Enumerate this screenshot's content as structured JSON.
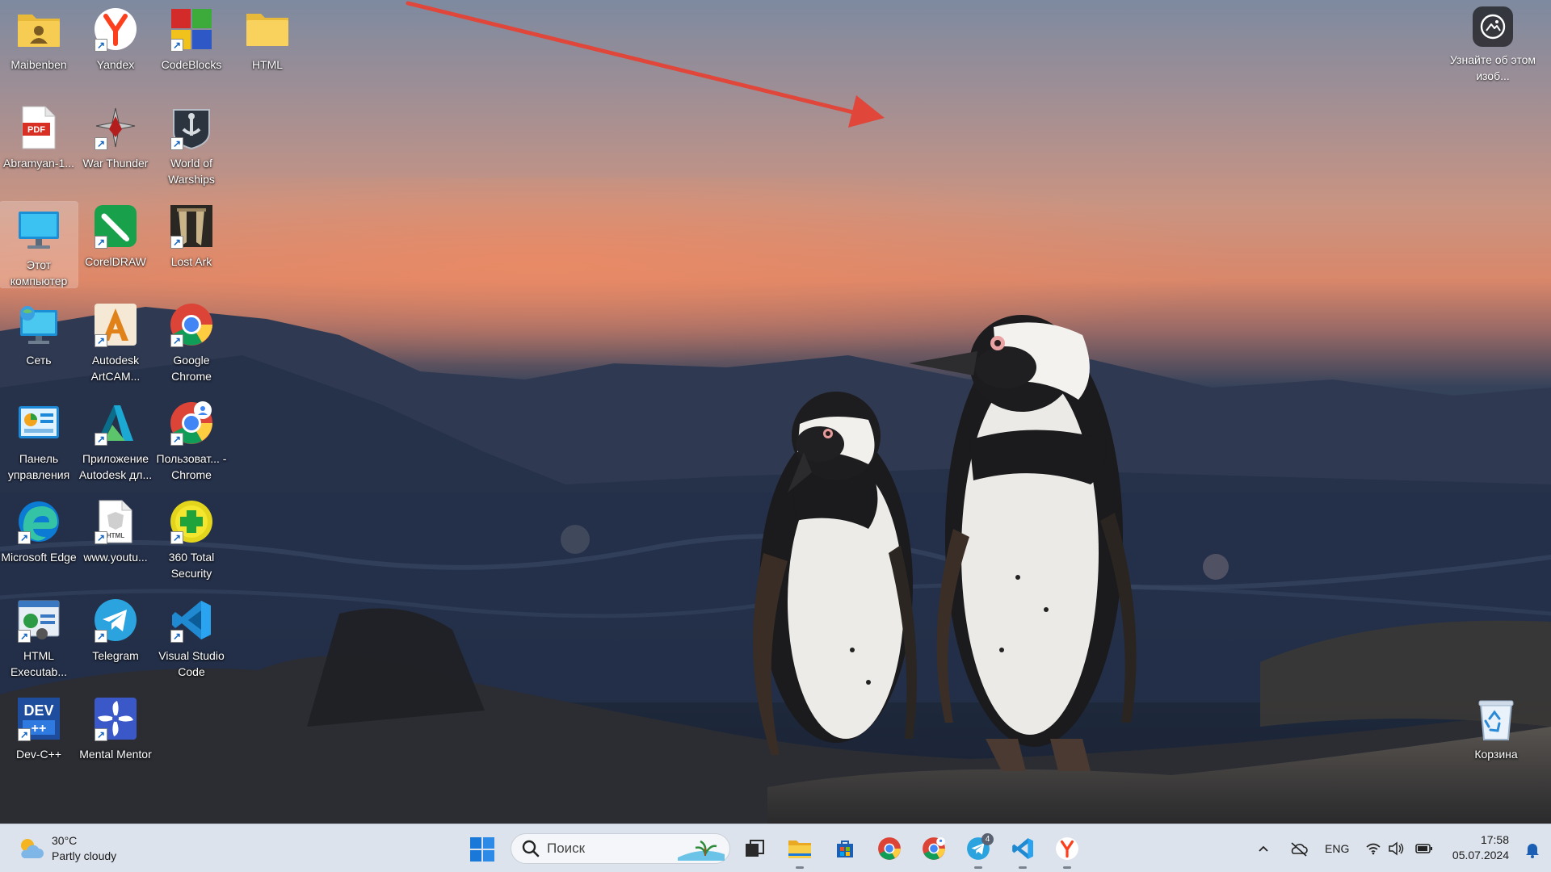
{
  "desktop": {
    "icons": [
      {
        "label": "Maibenben",
        "icon": "user-folder-icon"
      },
      {
        "label": "Yandex",
        "icon": "yandex-browser-icon"
      },
      {
        "label": "CodeBlocks",
        "icon": "codeblocks-icon"
      },
      {
        "label": "HTML",
        "icon": "folder-icon"
      },
      {
        "label": "Abramyan-1...",
        "icon": "pdf-file-icon"
      },
      {
        "label": "War Thunder",
        "icon": "war-thunder-icon"
      },
      {
        "label": "World of Warships",
        "icon": "world-of-warships-icon"
      },
      {
        "label": "Этот компьютер",
        "icon": "this-pc-icon"
      },
      {
        "label": "CorelDRAW",
        "icon": "coreldraw-icon"
      },
      {
        "label": "Lost Ark",
        "icon": "lost-ark-icon"
      },
      {
        "label": "Сеть",
        "icon": "network-icon"
      },
      {
        "label": "Autodesk ArtCAM...",
        "icon": "artcam-icon"
      },
      {
        "label": "Google Chrome",
        "icon": "chrome-icon"
      },
      {
        "label": "Панель управления",
        "icon": "control-panel-icon"
      },
      {
        "label": "Приложение Autodesk дл...",
        "icon": "autodesk-app-icon"
      },
      {
        "label": "Пользоват... - Chrome",
        "icon": "chrome-profile-icon"
      },
      {
        "label": "Microsoft Edge",
        "icon": "edge-icon"
      },
      {
        "label": "www.youtu...",
        "icon": "html-file-icon"
      },
      {
        "label": "360 Total Security",
        "icon": "360-security-icon"
      },
      {
        "label": "HTML Executab...",
        "icon": "html-executable-icon"
      },
      {
        "label": "Telegram",
        "icon": "telegram-icon"
      },
      {
        "label": "Visual Studio Code",
        "icon": "vscode-icon"
      },
      {
        "label": "Dev-C++",
        "icon": "devcpp-icon"
      },
      {
        "label": "Mental Mentor",
        "icon": "mental-mentor-icon"
      }
    ],
    "recycle_bin": {
      "label": "Корзина",
      "icon": "recycle-bin-icon"
    },
    "spotlight": {
      "label": "Узнайте об этом изоб...",
      "icon": "camera-info-icon"
    }
  },
  "taskbar": {
    "weather": {
      "temp": "30°C",
      "condition": "Partly cloudy",
      "icon": "partly-cloudy-icon"
    },
    "search_placeholder": "Поиск",
    "pinned": [
      {
        "name": "task-view",
        "icon": "task-view-icon",
        "running": false
      },
      {
        "name": "file-explorer",
        "icon": "file-explorer-icon",
        "running": true
      },
      {
        "name": "microsoft-store",
        "icon": "store-icon",
        "running": false
      },
      {
        "name": "google-chrome",
        "icon": "chrome-icon",
        "running": false
      },
      {
        "name": "chrome-profile",
        "icon": "chrome-profile-icon",
        "running": false
      },
      {
        "name": "telegram",
        "icon": "telegram-icon",
        "running": true,
        "badge": "4"
      },
      {
        "name": "vscode",
        "icon": "vscode-icon",
        "running": true
      },
      {
        "name": "yandex",
        "icon": "yandex-browser-icon",
        "running": true
      }
    ],
    "tray": {
      "language": "ENG"
    },
    "clock": {
      "time": "17:58",
      "date": "05.07.2024"
    }
  },
  "colors": {
    "arrow": "#e0463a",
    "taskbar": "#dde3ec",
    "accent": "#0067c0"
  }
}
